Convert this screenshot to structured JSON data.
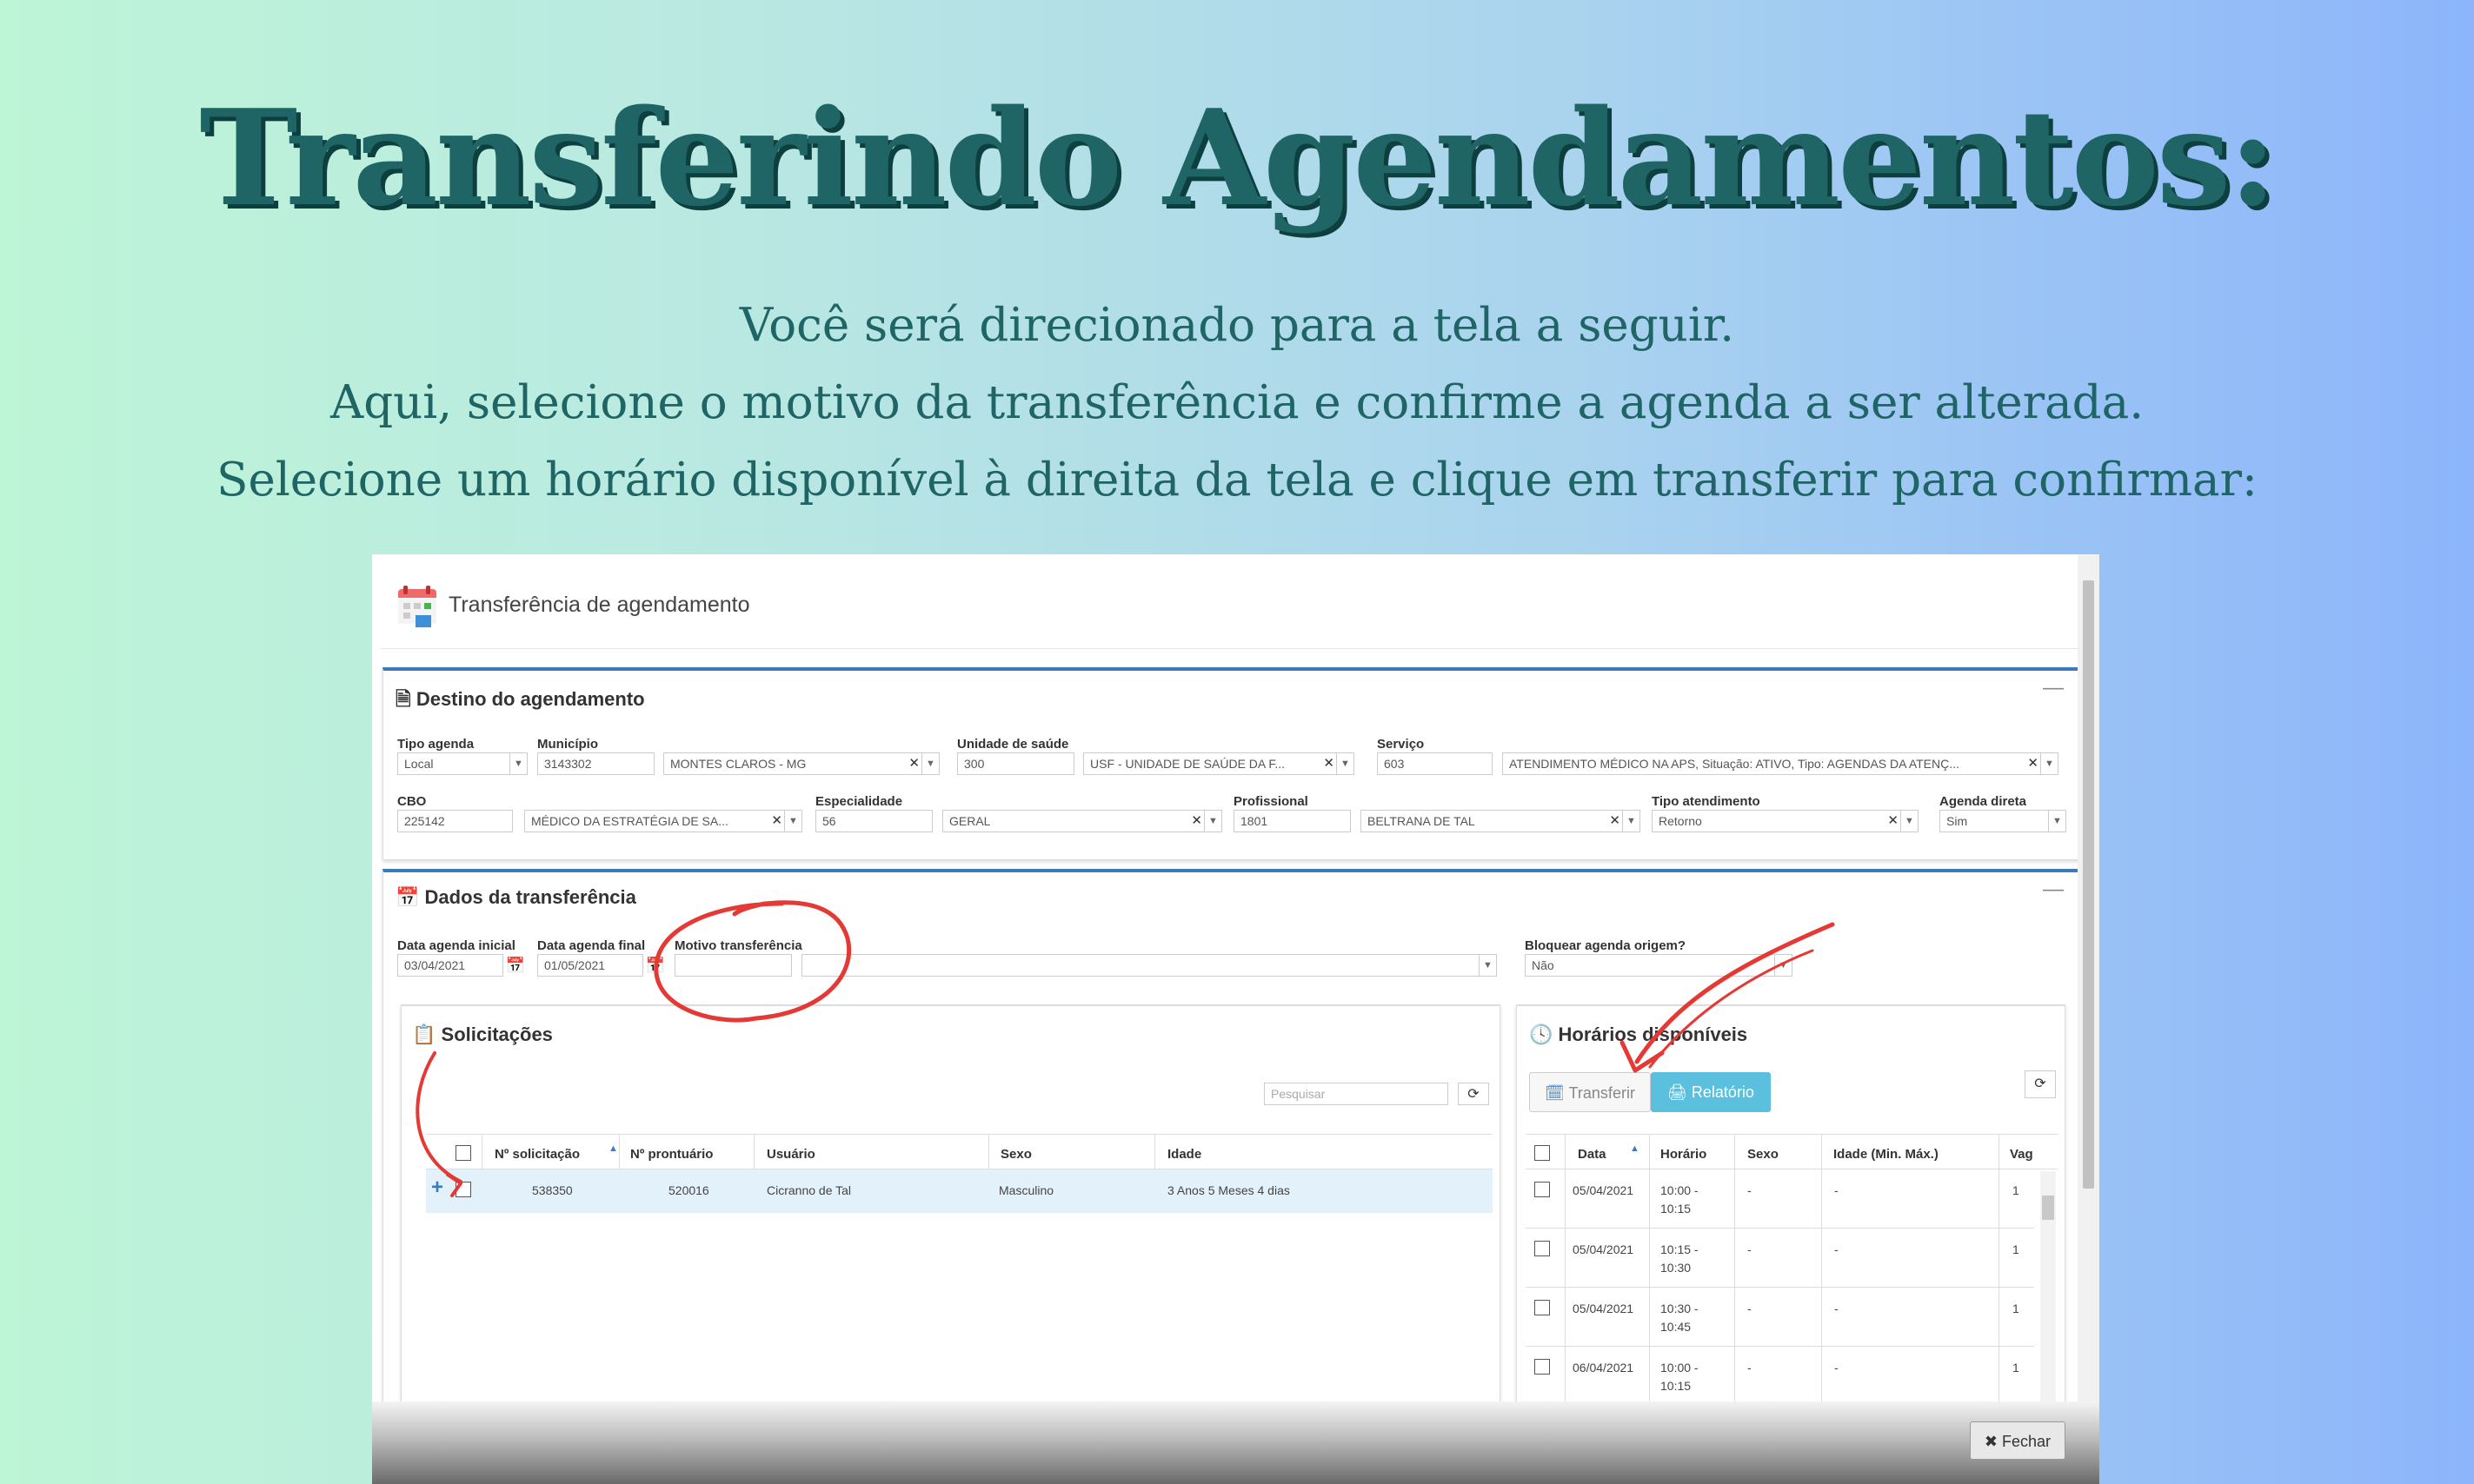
{
  "slide": {
    "title": "Transferindo  Agendamentos:",
    "lines": [
      "Você será direcionado para a tela a seguir.",
      "Aqui, selecione o motivo da transferência e confirme a agenda a ser alterada.",
      "Selecione um horário disponível à direita da tela e clique em transferir para confirmar:"
    ]
  },
  "window": {
    "title": "Transferência de agendamento"
  },
  "destino": {
    "heading": "Destino do agendamento",
    "tipo_agenda": {
      "label": "Tipo agenda",
      "value": "Local"
    },
    "municipio": {
      "label": "Município",
      "code": "3143302",
      "name": "MONTES CLAROS - MG"
    },
    "unidade": {
      "label": "Unidade de saúde",
      "code": "300",
      "name": "USF - UNIDADE DE SAÚDE DA F..."
    },
    "servico": {
      "label": "Serviço",
      "code": "603",
      "name": "ATENDIMENTO MÉDICO NA APS, Situação: ATIVO, Tipo: AGENDAS DA ATENÇ..."
    },
    "cbo": {
      "label": "CBO",
      "code": "225142",
      "name": "MÉDICO DA ESTRATÉGIA DE SA..."
    },
    "especialidade": {
      "label": "Especialidade",
      "code": "56",
      "name": "GERAL"
    },
    "profissional": {
      "label": "Profissional",
      "code": "1801",
      "name": "BELTRANA DE TAL"
    },
    "tipo_atendimento": {
      "label": "Tipo atendimento",
      "value": "Retorno"
    },
    "agenda_direta": {
      "label": "Agenda direta",
      "value": "Sim"
    }
  },
  "dados": {
    "heading": "Dados da transferência",
    "data_inicial": {
      "label": "Data agenda inicial",
      "value": "03/04/2021"
    },
    "data_final": {
      "label": "Data agenda final",
      "value": "01/05/2021"
    },
    "motivo": {
      "label": "Motivo transferência",
      "value": ""
    },
    "bloquear": {
      "label": "Bloquear agenda origem?",
      "value": "Não"
    }
  },
  "solicitacoes": {
    "heading": "Solicitações",
    "search_placeholder": "Pesquisar",
    "columns": [
      "Nº solicitação",
      "Nº prontuário",
      "Usuário",
      "Sexo",
      "Idade"
    ],
    "rows": [
      {
        "solicitacao": "538350",
        "prontuario": "520016",
        "usuario": "Cicranno de Tal",
        "sexo": "Masculino",
        "idade": "3 Anos 5 Meses 4 dias"
      }
    ]
  },
  "horarios": {
    "heading": "Horários disponíveis",
    "transferir_label": "Transferir",
    "relatorio_label": "Relatório",
    "columns": [
      "Data",
      "Horário",
      "Sexo",
      "Idade (Min. Máx.)",
      "Vag"
    ],
    "rows": [
      {
        "data": "05/04/2021",
        "h1": "10:00 -",
        "h2": "10:15",
        "sexo": "-",
        "idade": "-",
        "vag": "1"
      },
      {
        "data": "05/04/2021",
        "h1": "10:15 -",
        "h2": "10:30",
        "sexo": "-",
        "idade": "-",
        "vag": "1"
      },
      {
        "data": "05/04/2021",
        "h1": "10:30 -",
        "h2": "10:45",
        "sexo": "-",
        "idade": "-",
        "vag": "1"
      },
      {
        "data": "06/04/2021",
        "h1": "10:00 -",
        "h2": "10:15",
        "sexo": "-",
        "idade": "-",
        "vag": "1"
      }
    ]
  },
  "footer": {
    "fechar_label": "Fechar"
  },
  "colors": {
    "accent": "#3b7bbd",
    "annotation": "#e53935",
    "title": "#1f6565",
    "relatorio_bg": "#5bc0de"
  }
}
